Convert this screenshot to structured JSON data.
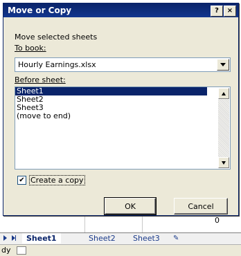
{
  "dialog": {
    "title": "Move or Copy",
    "help_button": "?",
    "close_button": "×",
    "instruction": "Move selected sheets",
    "to_book_label": "To book:",
    "to_book_value": "Hourly Earnings.xlsx",
    "before_sheet_label": "Before sheet:",
    "sheets": [
      "Sheet1",
      "Sheet2",
      "Sheet3",
      "(move to end)"
    ],
    "selected_sheet": "Sheet1",
    "create_copy_label": "Create a copy",
    "create_copy_checked": "✔",
    "ok_label": "OK",
    "cancel_label": "Cancel"
  },
  "workbook": {
    "cell_value": "0",
    "tabs": [
      "Sheet1",
      "Sheet2",
      "Sheet3"
    ],
    "status_text": "dy"
  }
}
